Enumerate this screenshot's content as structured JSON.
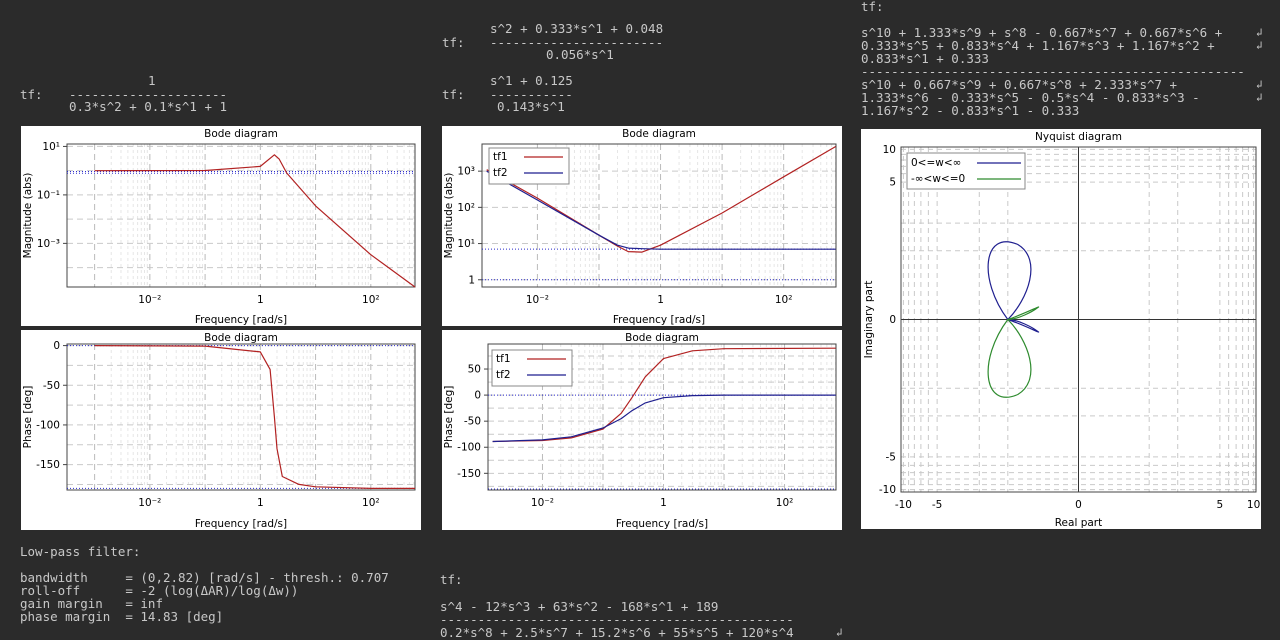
{
  "tf_labels": {
    "a": "tf:",
    "b1": "tf:",
    "b2": "tf:",
    "c": "tf:",
    "d": "tf:"
  },
  "tf_a": {
    "num": "1",
    "bar": "---------------------",
    "den": "0.3*s^2 + 0.1*s^1 + 1"
  },
  "tf_b1": {
    "num": "s^2 + 0.333*s^1 + 0.048",
    "bar": "-----------------------",
    "den": "0.056*s^1"
  },
  "tf_b2": {
    "num": "s^1 + 0.125",
    "bar": "-----------",
    "den": "0.143*s^1"
  },
  "tf_c": {
    "num1": "s^10 + 1.333*s^9 + s^8 - 0.667*s^7 + 0.667*s^6 +",
    "num2": "0.333*s^5 + 0.833*s^4 + 1.167*s^3 + 1.167*s^2 +",
    "num3": "0.833*s^1 + 0.333",
    "bar": "---------------------------------------------------",
    "den1": "s^10 + 0.667*s^9 + 0.667*s^8 + 2.333*s^7 +",
    "den2": "1.333*s^6 - 0.333*s^5 - 0.5*s^4 - 0.833*s^3 -",
    "den3": "1.167*s^2 - 0.833*s^1 - 0.333"
  },
  "tf_d": {
    "num": "s^4 - 12*s^3 + 63*s^2 - 168*s^1 + 189",
    "bar": "-----------------------------------------------",
    "den": "0.2*s^8 + 2.5*s^7 + 15.2*s^6 + 55*s^5 + 120*s^4"
  },
  "wrap_mark": "↲",
  "lowpass": {
    "title": "Low-pass filter:",
    "rows": [
      "bandwidth     = (0,2.82) [rad/s] - thresh.: 0.707",
      "roll-off      = -2 (log(ΔAR)/log(Δw))",
      "gain margin   = inf",
      "phase margin  = 14.83 [deg]"
    ]
  },
  "colors": {
    "bg": "#2b2b2b",
    "text": "#c8c8c8",
    "red": "#b22222",
    "blue": "#1f1f8f",
    "green": "#2e8b2e"
  },
  "chart_data": [
    {
      "type": "line",
      "title": "Bode diagram",
      "xlabel": "Frequency [rad/s]",
      "ylabel": "Magnitude (abs)",
      "xscale": "log",
      "yscale": "log",
      "xticks": [
        "10⁻²",
        "1",
        "10²"
      ],
      "yticks": [
        "10¹",
        "10⁻¹",
        "10⁻³"
      ],
      "series": [
        {
          "x": [
            0.001,
            0.1,
            1,
            1.8,
            2.2,
            3,
            10,
            100,
            1000
          ],
          "values": [
            1,
            1.02,
            1.5,
            4.5,
            3,
            0.8,
            0.035,
            0.00034,
            3.4e-06
          ]
        }
      ]
    },
    {
      "type": "line",
      "title": "Bode diagram",
      "xlabel": "Frequency [rad/s]",
      "ylabel": "Phase [deg]",
      "xscale": "log",
      "xticks": [
        "10⁻²",
        "1",
        "10²"
      ],
      "yticks": [
        "0",
        "-50",
        "-100",
        "-150"
      ],
      "series": [
        {
          "x": [
            0.001,
            0.1,
            1,
            1.5,
            1.8,
            2,
            2.5,
            5,
            10,
            100,
            1000
          ],
          "values": [
            0,
            -0.6,
            -8,
            -30,
            -90,
            -130,
            -165,
            -175,
            -178,
            -180,
            -180
          ]
        }
      ]
    },
    {
      "type": "line",
      "title": "Bode diagram",
      "xlabel": "Frequency [rad/s]",
      "ylabel": "Magnitude (abs)",
      "xscale": "log",
      "yscale": "log",
      "xticks": [
        "10⁻²",
        "1",
        "10²"
      ],
      "yticks": [
        "10³",
        "10²",
        "10¹",
        "1"
      ],
      "series": [
        {
          "name": "tf1",
          "x": [
            0.0015,
            0.01,
            0.1,
            0.2,
            0.3,
            0.5,
            1,
            10,
            100,
            700
          ],
          "values": [
            1100,
            180,
            17,
            8.5,
            6,
            5.8,
            9,
            70,
            700,
            4800
          ]
        },
        {
          "name": "tf2",
          "x": [
            0.0015,
            0.01,
            0.1,
            0.2,
            0.3,
            0.5,
            1,
            10,
            100,
            700
          ],
          "values": [
            1000,
            160,
            17,
            9,
            7.5,
            7.2,
            7,
            7,
            7,
            7
          ]
        }
      ]
    },
    {
      "type": "line",
      "title": "Bode diagram",
      "xlabel": "Frequency [rad/s]",
      "ylabel": "Phase [deg]",
      "xscale": "log",
      "xticks": [
        "10⁻²",
        "1",
        "10²"
      ],
      "yticks": [
        "50",
        "0",
        "-50",
        "-100",
        "-150"
      ],
      "series": [
        {
          "name": "tf1",
          "x": [
            0.0015,
            0.01,
            0.03,
            0.1,
            0.2,
            0.3,
            0.5,
            1,
            3,
            10,
            700
          ],
          "values": [
            -89,
            -87,
            -82,
            -65,
            -35,
            -5,
            35,
            70,
            85,
            89,
            90
          ]
        },
        {
          "name": "tf2",
          "x": [
            0.0015,
            0.01,
            0.03,
            0.1,
            0.2,
            0.3,
            0.5,
            1,
            3,
            10,
            700
          ],
          "values": [
            -89,
            -86,
            -80,
            -63,
            -45,
            -30,
            -15,
            -5,
            -1,
            0,
            0
          ]
        }
      ]
    },
    {
      "type": "line",
      "title": "Nyquist diagram",
      "xlabel": "Real part",
      "ylabel": "Imaginary part",
      "xticks": [
        "-10",
        "-5",
        "0",
        "5",
        "10"
      ],
      "yticks": [
        "10",
        "5",
        "0",
        "-5",
        "-10"
      ],
      "series": [
        {
          "name": "0<=w<∞"
        },
        {
          "name": "-∞<w<=0"
        }
      ]
    }
  ]
}
